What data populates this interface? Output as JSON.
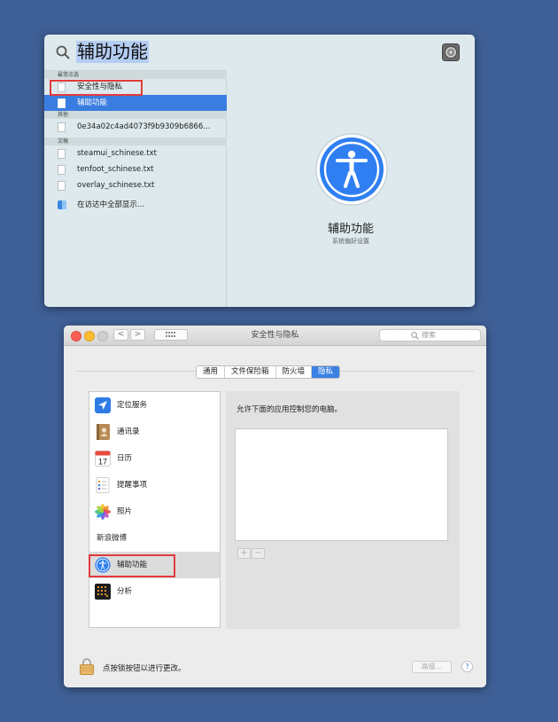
{
  "spotlight": {
    "query": "辅助功能",
    "groups": {
      "top_hits": "最常点选",
      "other": "其他",
      "documents": "文稿"
    },
    "items": {
      "security": "安全性与隐私",
      "accessibility": "辅助功能",
      "hash_file": "0e34a02c4ad4073f9b9309b6866...",
      "steamui": "steamui_schinese.txt",
      "tenfoot": "tenfoot_schinese.txt",
      "overlay": "overlay_schinese.txt",
      "show_all_finder": "在访达中全部显示..."
    },
    "preview": {
      "title": "辅助功能",
      "subtitle": "系统偏好设置"
    },
    "colors": {
      "selection": "#3a7de0",
      "query_highlight": "#b4cdf3",
      "accent_icon": "#2f7ff2"
    }
  },
  "prefs": {
    "window_title": "安全性与隐私",
    "search_placeholder": "搜索",
    "nav": {
      "back": "<",
      "forward": ">"
    },
    "tabs": [
      "通用",
      "文件保险箱",
      "防火墙",
      "隐私"
    ],
    "active_tab": "隐私",
    "apps": [
      {
        "label": "定位服务",
        "icon": "location-arrow-icon"
      },
      {
        "label": "通讯录",
        "icon": "contacts-book-icon"
      },
      {
        "label": "日历",
        "icon": "calendar-icon",
        "day": "17"
      },
      {
        "label": "提醒事项",
        "icon": "reminders-icon"
      },
      {
        "label": "照片",
        "icon": "photos-icon"
      },
      {
        "label": "新浪微博",
        "icon": ""
      },
      {
        "label": "辅助功能",
        "icon": "accessibility-icon"
      },
      {
        "label": "分析",
        "icon": "analytics-icon"
      }
    ],
    "selected_app": "辅助功能",
    "right_pane_text": "允许下面的应用控制您的电脑。",
    "add_label": "+",
    "remove_label": "−",
    "lock_text": "点按锁按钮以进行更改。",
    "advanced_label": "高级...",
    "help_label": "?",
    "colors": {
      "active_tab": "#3b82e4",
      "highlight_box": "#e23b3b"
    }
  }
}
